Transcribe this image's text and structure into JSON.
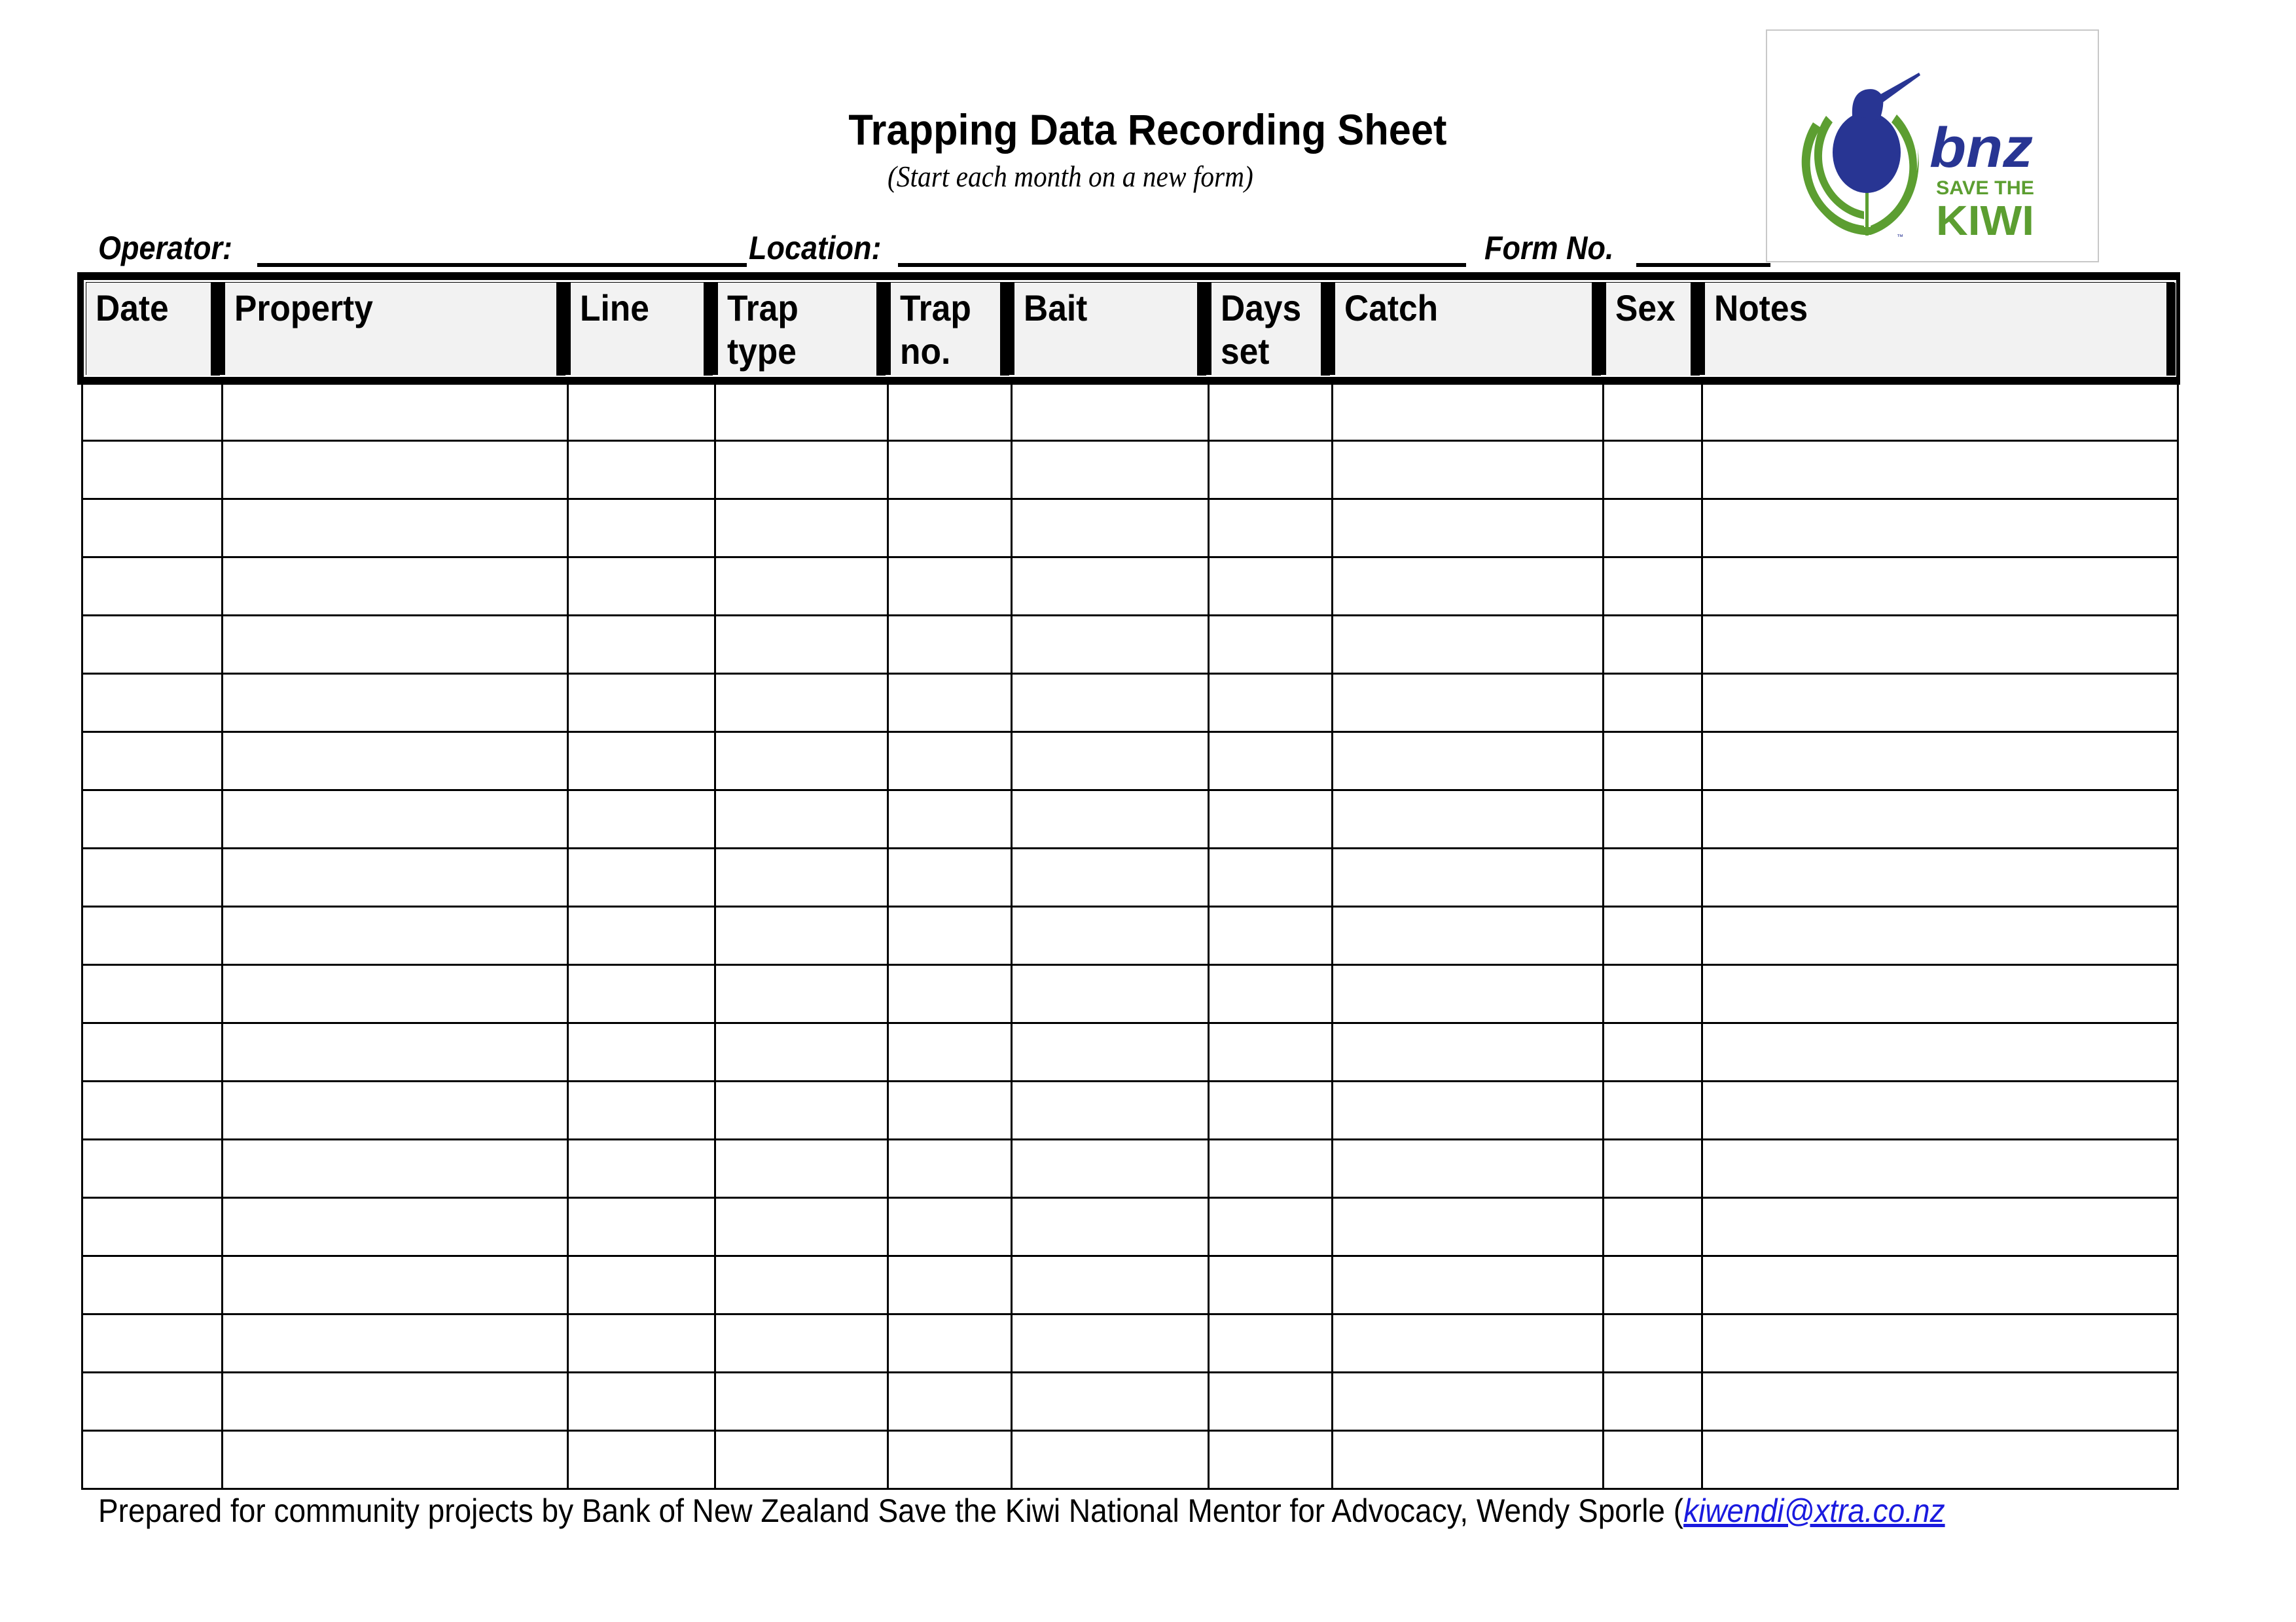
{
  "document": {
    "title": "Trapping Data Recording Sheet",
    "subtitle": "(Start each month on a new form)"
  },
  "logo": {
    "brand": "bnz",
    "tagline_top": "SAVE THE",
    "tagline_bottom": "KIWI",
    "trademark": "™",
    "colors": {
      "blue": "#283593",
      "green": "#5c9e31"
    }
  },
  "fields": {
    "operator_label": "Operator:",
    "location_label": "Location:",
    "form_no_label": "Form No.",
    "operator_value": "",
    "location_value": "",
    "form_no_value": ""
  },
  "table": {
    "columns": [
      {
        "label": "Date"
      },
      {
        "label": "Property"
      },
      {
        "label": "Line"
      },
      {
        "label": "Trap\ntype"
      },
      {
        "label": "Trap\nno."
      },
      {
        "label": "Bait"
      },
      {
        "label": "Days\nset"
      },
      {
        "label": "Catch"
      },
      {
        "label": "Sex"
      },
      {
        "label": "Notes"
      }
    ],
    "row_count": 19,
    "rows": [
      [
        "",
        "",
        "",
        "",
        "",
        "",
        "",
        "",
        "",
        ""
      ],
      [
        "",
        "",
        "",
        "",
        "",
        "",
        "",
        "",
        "",
        ""
      ],
      [
        "",
        "",
        "",
        "",
        "",
        "",
        "",
        "",
        "",
        ""
      ],
      [
        "",
        "",
        "",
        "",
        "",
        "",
        "",
        "",
        "",
        ""
      ],
      [
        "",
        "",
        "",
        "",
        "",
        "",
        "",
        "",
        "",
        ""
      ],
      [
        "",
        "",
        "",
        "",
        "",
        "",
        "",
        "",
        "",
        ""
      ],
      [
        "",
        "",
        "",
        "",
        "",
        "",
        "",
        "",
        "",
        ""
      ],
      [
        "",
        "",
        "",
        "",
        "",
        "",
        "",
        "",
        "",
        ""
      ],
      [
        "",
        "",
        "",
        "",
        "",
        "",
        "",
        "",
        "",
        ""
      ],
      [
        "",
        "",
        "",
        "",
        "",
        "",
        "",
        "",
        "",
        ""
      ],
      [
        "",
        "",
        "",
        "",
        "",
        "",
        "",
        "",
        "",
        ""
      ],
      [
        "",
        "",
        "",
        "",
        "",
        "",
        "",
        "",
        "",
        ""
      ],
      [
        "",
        "",
        "",
        "",
        "",
        "",
        "",
        "",
        "",
        ""
      ],
      [
        "",
        "",
        "",
        "",
        "",
        "",
        "",
        "",
        "",
        ""
      ],
      [
        "",
        "",
        "",
        "",
        "",
        "",
        "",
        "",
        "",
        ""
      ],
      [
        "",
        "",
        "",
        "",
        "",
        "",
        "",
        "",
        "",
        ""
      ],
      [
        "",
        "",
        "",
        "",
        "",
        "",
        "",
        "",
        "",
        ""
      ],
      [
        "",
        "",
        "",
        "",
        "",
        "",
        "",
        "",
        "",
        ""
      ],
      [
        "",
        "",
        "",
        "",
        "",
        "",
        "",
        "",
        "",
        ""
      ]
    ]
  },
  "footer": {
    "text": "Prepared for community projects by Bank of New Zealand Save the Kiwi National Mentor for Advocacy,  Wendy Sporle (",
    "email": "kiwendi@xtra.co.nz",
    "link_color": "#1a1adf"
  }
}
